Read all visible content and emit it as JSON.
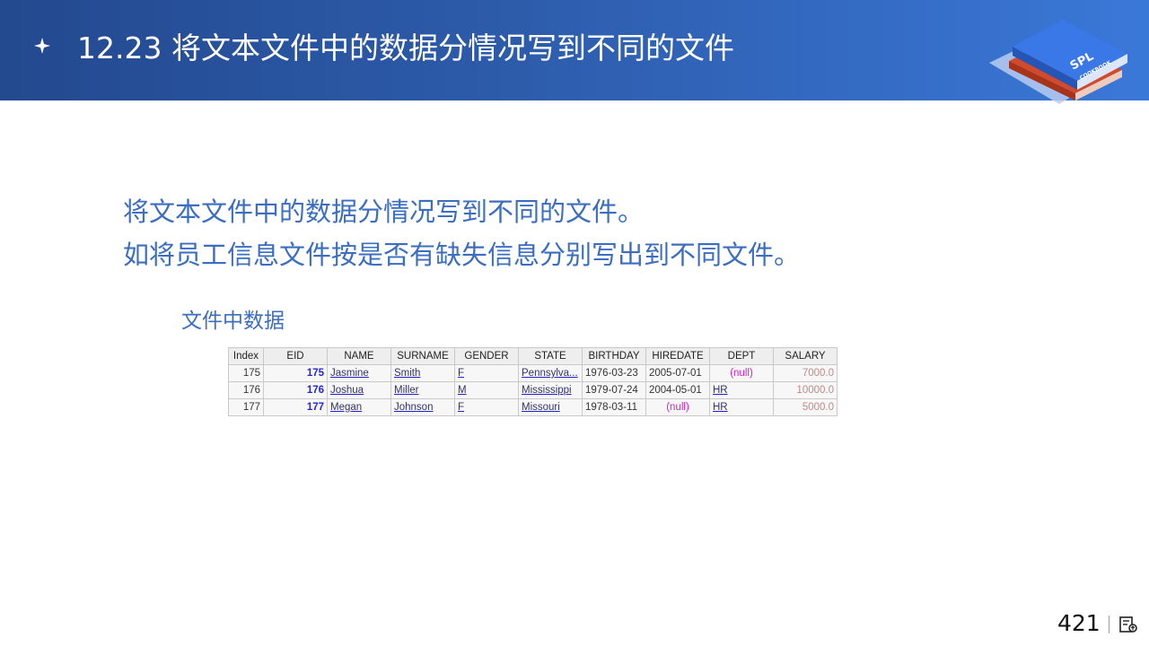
{
  "header": {
    "bullet_icon": "sparkle-icon",
    "title": "12.23 将文本文件中的数据分情况写到不同的文件",
    "logo": {
      "brand": "SPL",
      "sub": "COOKBOOK"
    }
  },
  "body": {
    "lines": [
      "将文本文件中的数据分情况写到不同的文件。",
      "如将员工信息文件按是否有缺失信息分别写出到不同文件。"
    ],
    "table_caption": "文件中数据"
  },
  "table": {
    "columns": [
      "Index",
      "EID",
      "NAME",
      "SURNAME",
      "GENDER",
      "STATE",
      "BIRTHDAY",
      "HIREDATE",
      "DEPT",
      "SALARY"
    ],
    "rows": [
      [
        "175",
        "175",
        "Jasmine",
        "Smith",
        "F",
        "Pennsylva...",
        "1976-03-23",
        "2005-07-01",
        "(null)",
        "7000.0"
      ],
      [
        "176",
        "176",
        "Joshua",
        "Miller",
        "M",
        "Mississippi",
        "1979-07-24",
        "2004-05-01",
        "HR",
        "10000.0"
      ],
      [
        "177",
        "177",
        "Megan",
        "Johnson",
        "F",
        "Missouri",
        "1978-03-11",
        "(null)",
        "HR",
        "5000.0"
      ]
    ]
  },
  "footer": {
    "page_number": "421",
    "icon": "notes-icon"
  },
  "colors": {
    "header_start": "#23498f",
    "header_end": "#3a78d8",
    "body_text": "#3b6ec2",
    "null_text": "#d020d0",
    "eid_text": "#2323e6",
    "salary_text": "#c48888"
  }
}
